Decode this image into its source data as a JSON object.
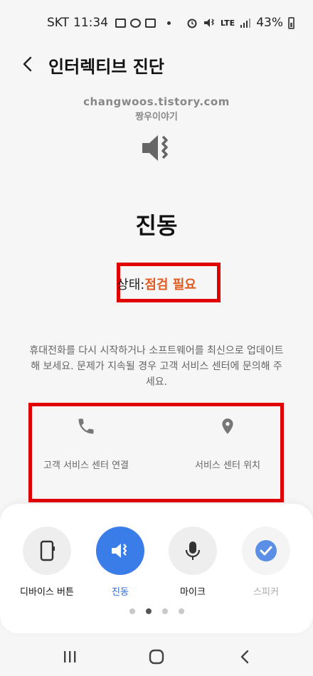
{
  "status_bar": {
    "carrier": "SKT",
    "time": "11:34",
    "network": "LTE",
    "battery": "43%"
  },
  "header": {
    "title": "인터렉티브 진단",
    "back_icon": "chevron-left-icon"
  },
  "watermark": {
    "line1": "changwoos.tistory.com",
    "line2": "짱우이야기"
  },
  "test_item": {
    "icon": "vibrate-icon",
    "name": "진동",
    "status_label": "상태:",
    "status_value": "점검 필요",
    "status_color": "#e05a1f"
  },
  "description": "휴대전화를 다시 시작하거나 소프트웨어를 최신으로 업데이트해 보세요. 문제가 지속될 경우 고객 서비스 센터에 문의해 주세요.",
  "support_actions": [
    {
      "icon": "phone-icon",
      "label": "고객 서비스 센터 연결"
    },
    {
      "icon": "location-pin-icon",
      "label": "서비스 센터 위치"
    }
  ],
  "diagnostic_tests": [
    {
      "icon": "device-button-icon",
      "label": "디바이스 버튼",
      "state": "normal"
    },
    {
      "icon": "vibrate-icon",
      "label": "진동",
      "state": "active"
    },
    {
      "icon": "microphone-icon",
      "label": "마이크",
      "state": "normal"
    },
    {
      "icon": "check-icon",
      "label": "스피커",
      "state": "faded"
    }
  ],
  "pager": {
    "pages": 4,
    "current": 2
  },
  "colors": {
    "accent": "#3a7de8",
    "highlight_border": "#e10000",
    "background": "#f6f6f6"
  }
}
